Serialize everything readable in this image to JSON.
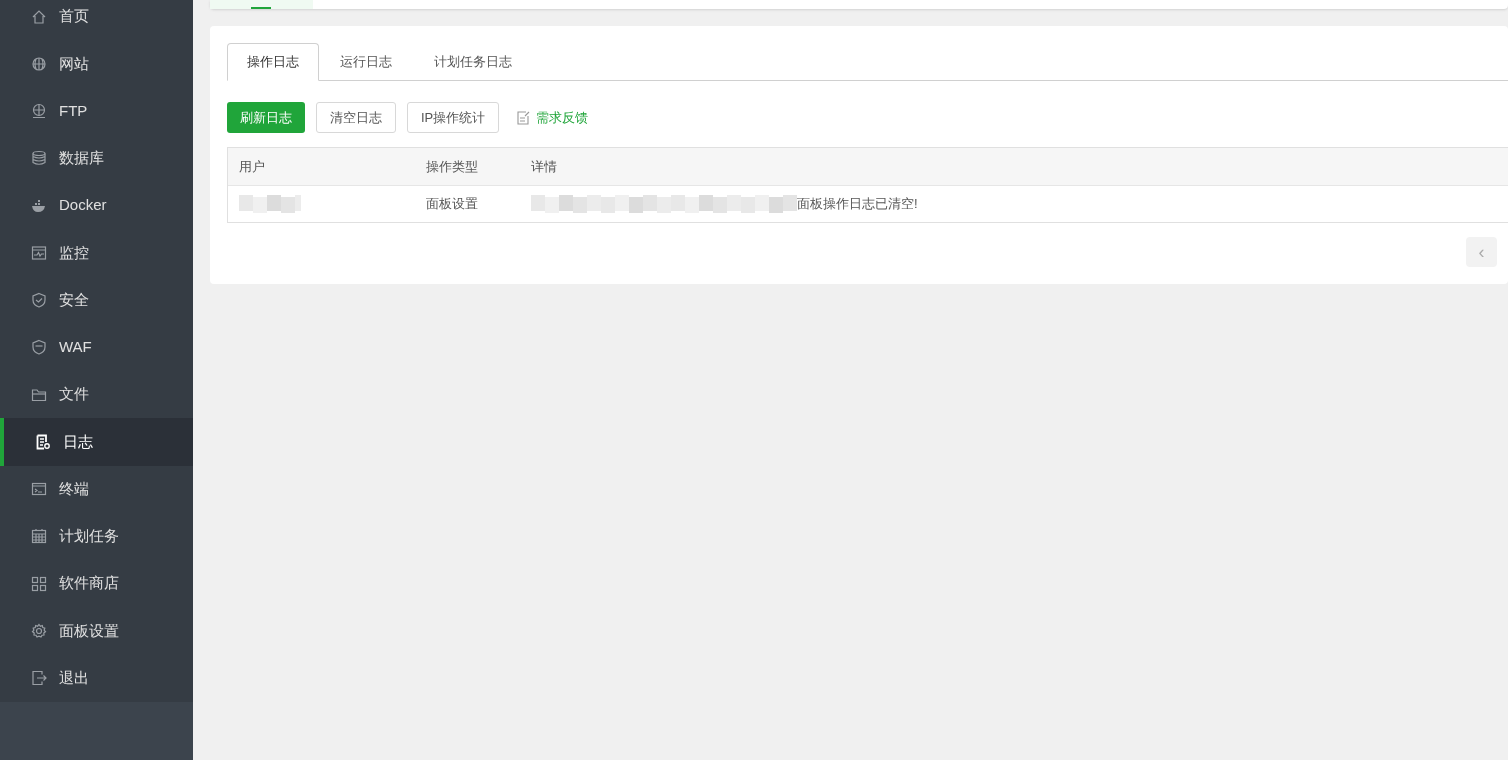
{
  "sidebar": {
    "items": [
      {
        "label": "首页",
        "selected": false
      },
      {
        "label": "网站",
        "selected": false
      },
      {
        "label": "FTP",
        "selected": false
      },
      {
        "label": "数据库",
        "selected": false
      },
      {
        "label": "Docker",
        "selected": false
      },
      {
        "label": "监控",
        "selected": false
      },
      {
        "label": "安全",
        "selected": false
      },
      {
        "label": "WAF",
        "selected": false
      },
      {
        "label": "文件",
        "selected": false
      },
      {
        "label": "日志",
        "selected": true
      },
      {
        "label": "终端",
        "selected": false
      },
      {
        "label": "计划任务",
        "selected": false
      },
      {
        "label": "软件商店",
        "selected": false
      },
      {
        "label": "面板设置",
        "selected": false
      },
      {
        "label": "退出",
        "selected": false
      }
    ]
  },
  "top_tabs": [
    {
      "selected": true
    }
  ],
  "tabs": [
    {
      "label": "操作日志",
      "selected": true
    },
    {
      "label": "运行日志",
      "selected": false
    },
    {
      "label": "计划任务日志",
      "selected": false
    }
  ],
  "toolbar": {
    "buttons": [
      {
        "label": "刷新日志",
        "kind": "primary"
      },
      {
        "label": "清空日志",
        "kind": "default"
      },
      {
        "label": "IP操作统计",
        "kind": "default"
      }
    ],
    "feedback_link": "需求反馈"
  },
  "table": {
    "columns": [
      "用户",
      "操作类型",
      "详情"
    ],
    "rows": [
      {
        "user_redacted": true,
        "type": "面板设置",
        "detail_redacted": true,
        "detail": "面板操作日志已清空!"
      }
    ]
  },
  "pagination": {
    "prev": "‹"
  }
}
